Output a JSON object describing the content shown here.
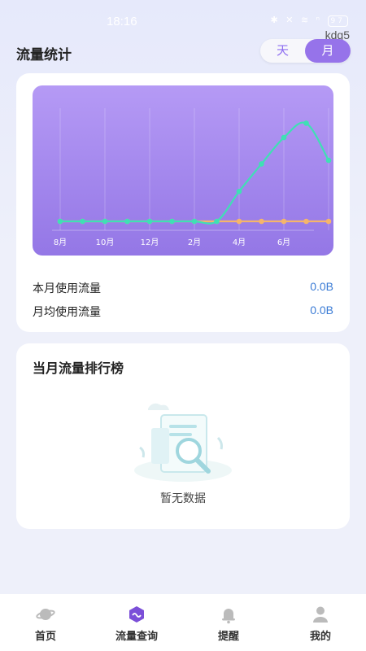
{
  "status_bar": {
    "time": "18:16",
    "icons": "✱ ✕ ≋ ⁿ",
    "battery": "97"
  },
  "watermark": "kdq5",
  "header": {
    "title": "流量统计"
  },
  "toggle": {
    "day_label": "天",
    "month_label": "月",
    "selected": "月"
  },
  "usage": {
    "this_month_label": "本月使用流量",
    "this_month_value": "0.0B",
    "avg_month_label": "月均使用流量",
    "avg_month_value": "0.0B"
  },
  "chart_data": {
    "type": "line",
    "x_tick_labels": [
      "8月",
      "10月",
      "12月",
      "2月",
      "4月",
      "6月"
    ],
    "series": [
      {
        "color": "#3fe0b4",
        "values": [
          0,
          0,
          0,
          0,
          0,
          0,
          0,
          0,
          25,
          48,
          70,
          82,
          51
        ]
      },
      {
        "color": "#f5b56b",
        "values": [
          0,
          0,
          0,
          0,
          0,
          0,
          0,
          0,
          0,
          0,
          0,
          0,
          0
        ]
      }
    ],
    "grid": "vertical"
  },
  "ranking": {
    "title": "当月流量排行榜",
    "empty_text": "暂无数据"
  },
  "tabbar": {
    "items": [
      {
        "label": "首页",
        "icon": "planet-icon"
      },
      {
        "label": "流量查询",
        "icon": "traffic-icon"
      },
      {
        "label": "提醒",
        "icon": "bell-icon"
      },
      {
        "label": "我的",
        "icon": "user-icon"
      }
    ]
  }
}
